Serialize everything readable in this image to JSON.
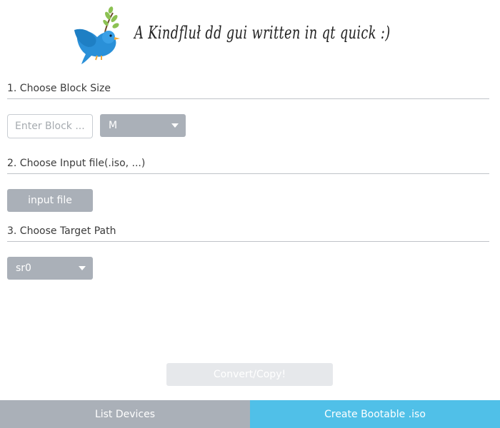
{
  "header": {
    "title": "A Kindfluł dd gui written in qt quick :)"
  },
  "sections": {
    "block_size": {
      "label": "1. Choose Block Size",
      "input_placeholder": "Enter Block ...",
      "unit_selected": "M"
    },
    "input_file": {
      "label": "2. Choose Input file(.iso, ...)",
      "button_label": "input file"
    },
    "target_path": {
      "label": "3. Choose Target Path",
      "device_selected": "sr0"
    }
  },
  "actions": {
    "convert_label": "Convert/Copy!"
  },
  "bottom_bar": {
    "list_devices": "List Devices",
    "create_iso": "Create Bootable .iso"
  },
  "colors": {
    "accent": "#50c0e8",
    "control_gray": "#aab0b8",
    "disabled": "#e6e8eb",
    "bird_blue": "#2a90d8"
  },
  "icons": {
    "logo": "dove-with-olive-branch-icon",
    "dropdown": "chevron-down-icon"
  }
}
